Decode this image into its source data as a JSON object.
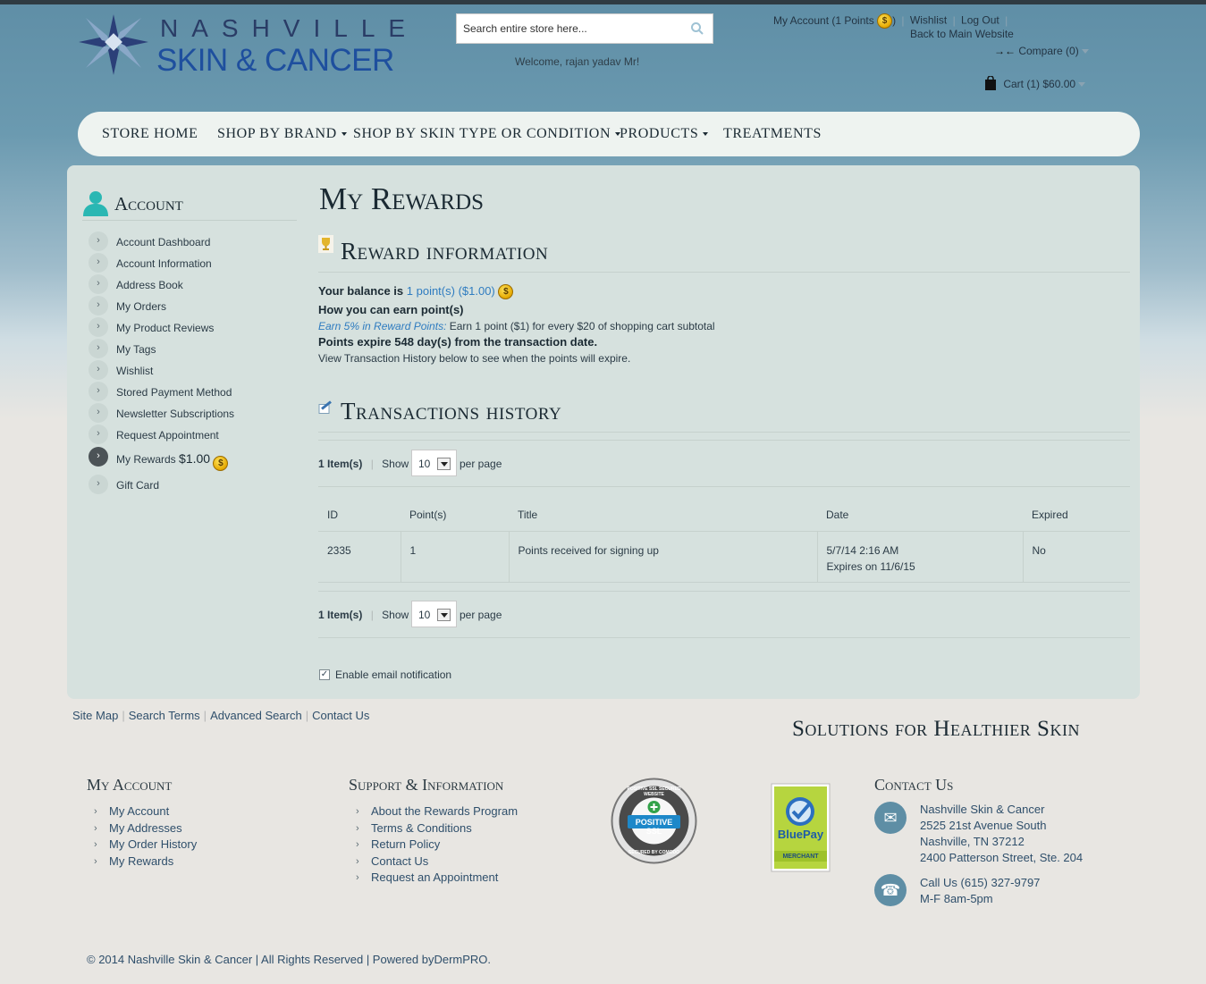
{
  "brand": {
    "logo_line1": "NASHVILLE",
    "logo_line2": "SKIN & CANCER"
  },
  "search": {
    "placeholder": "Search entire store here..."
  },
  "header": {
    "welcome": "Welcome, rajan yadav Mr!",
    "my_account": "My Account (1 Points",
    "my_account_close": ")",
    "wishlist": "Wishlist",
    "logout": "Log Out",
    "back_to_main": "Back to Main Website",
    "compare": "Compare (0)",
    "cart": "Cart (1)  $60.00"
  },
  "nav": {
    "items": [
      {
        "label": "Store Home"
      },
      {
        "label": "Shop by Brand"
      },
      {
        "label": "Shop by Skin Type or Condition"
      },
      {
        "label": "Products"
      },
      {
        "label": "Treatments"
      }
    ]
  },
  "sidebar": {
    "title": "Account",
    "items": [
      {
        "label": "Account Dashboard"
      },
      {
        "label": "Account Information"
      },
      {
        "label": "Address Book"
      },
      {
        "label": "My Orders"
      },
      {
        "label": "My Product Reviews"
      },
      {
        "label": "My Tags"
      },
      {
        "label": "Wishlist"
      },
      {
        "label": "Stored Payment Method"
      },
      {
        "label": "Newsletter Subscriptions"
      },
      {
        "label": "Request Appointment"
      },
      {
        "label": "My Rewards",
        "amount": "$1.00"
      },
      {
        "label": "Gift Card"
      }
    ]
  },
  "main": {
    "title": "My Rewards",
    "reward_info": {
      "heading": "Reward information",
      "balance_prefix": "Your balance is",
      "balance_value": "1 point(s) ($1.00)",
      "how_to_earn": "How you can earn point(s)",
      "earn_rule_title": "Earn 5% in Reward Points:",
      "earn_rule_text": "Earn 1 point ($1) for every $20 of shopping cart subtotal",
      "expire_note": "Points expire 548 day(s) from the transaction date.",
      "history_note": "View Transaction History below to see when the points will expire."
    },
    "transactions": {
      "heading": "Transactions history",
      "item_count": "1 Item(s)",
      "show_label": "Show",
      "per_page_value": "10",
      "per_page_label": "per page",
      "columns": [
        "ID",
        "Point(s)",
        "Title",
        "Date",
        "Expired"
      ],
      "rows": [
        {
          "id": "2335",
          "points": "1",
          "title": "Points received for signing up",
          "date": "5/7/14 2:16 AM",
          "expires": "Expires on 11/6/15",
          "expired": "No"
        }
      ]
    },
    "email_notification": {
      "label": "Enable email notification",
      "checked": true
    }
  },
  "footer": {
    "links": [
      "Site Map",
      "Search Terms",
      "Advanced Search",
      "Contact Us"
    ],
    "tagline": "Solutions for Healthier Skin",
    "my_account": {
      "title": "My Account",
      "items": [
        "My Account",
        "My Addresses",
        "My Order History",
        "My Rewards"
      ]
    },
    "support": {
      "title": "Support & Information",
      "items": [
        "About the Rewards Program",
        "Terms & Conditions",
        "Return Policy",
        "Contact Us",
        "Request an Appointment"
      ]
    },
    "ssl_badge": {
      "top": "POSITIVE SSL SECURED WEBSITE",
      "main": "POSITIVE SSL",
      "bottom": "SECURED BY COMODO"
    },
    "bluepay_badge": {
      "name": "BluePay",
      "sub": "MERCHANT"
    },
    "contact": {
      "title": "Contact Us",
      "address": [
        "Nashville Skin & Cancer",
        "2525 21st Avenue South",
        "Nashville, TN 37212",
        "2400 Patterson Street, Ste. 204"
      ],
      "phone": [
        "Call Us (615) 327-9797",
        "M-F 8am-5pm"
      ]
    },
    "copyright": "© 2014 Nashville Skin & Cancer | All Rights Reserved | Powered by",
    "powered_by": "DermPRO",
    "copyright_end": "."
  },
  "colors": {
    "accent_blue": "#2f7cc0",
    "header_blue": "#6b9ab0",
    "panel": "#d6e1de",
    "brand_navy": "#1e4f9e"
  },
  "icons": [
    "search-icon",
    "coin-icon",
    "compare-icon",
    "cart-icon",
    "account-user-icon",
    "trophy-icon",
    "transactions-icon",
    "chevron-right-icon",
    "mail-icon",
    "phone-icon"
  ]
}
